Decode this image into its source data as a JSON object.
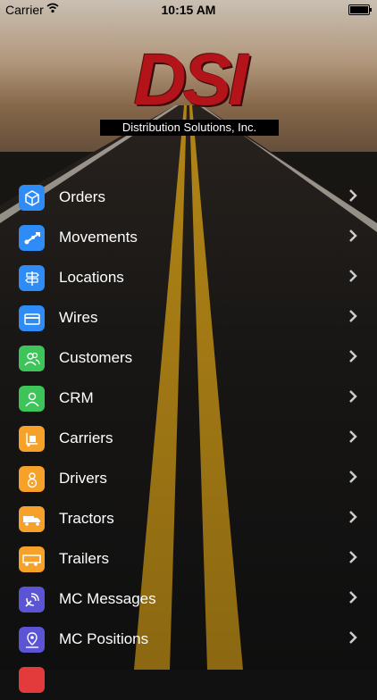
{
  "status_bar": {
    "carrier": "Carrier",
    "time": "10:15 AM"
  },
  "logo": {
    "mark": "DSI",
    "subtitle": "Distribution Solutions, Inc."
  },
  "menu": [
    {
      "label": "Orders",
      "icon": "box-icon",
      "color": "#2f8cf6"
    },
    {
      "label": "Movements",
      "icon": "route-icon",
      "color": "#2f8cf6"
    },
    {
      "label": "Locations",
      "icon": "signpost-icon",
      "color": "#2f8cf6"
    },
    {
      "label": "Wires",
      "icon": "card-icon",
      "color": "#2f8cf6"
    },
    {
      "label": "Customers",
      "icon": "people-icon",
      "color": "#3ec55a"
    },
    {
      "label": "CRM",
      "icon": "person-icon",
      "color": "#3ec55a"
    },
    {
      "label": "Carriers",
      "icon": "hand-truck-icon",
      "color": "#f6a12a"
    },
    {
      "label": "Drivers",
      "icon": "driver-icon",
      "color": "#f6a12a"
    },
    {
      "label": "Tractors",
      "icon": "truck-icon",
      "color": "#f6a12a"
    },
    {
      "label": "Trailers",
      "icon": "trailer-icon",
      "color": "#f6a12a"
    },
    {
      "label": "MC Messages",
      "icon": "satellite-icon",
      "color": "#5b55d6"
    },
    {
      "label": "MC Positions",
      "icon": "map-pin-icon",
      "color": "#5b55d6"
    },
    {
      "label": "",
      "icon": "red-icon",
      "color": "#e33b3b"
    }
  ]
}
